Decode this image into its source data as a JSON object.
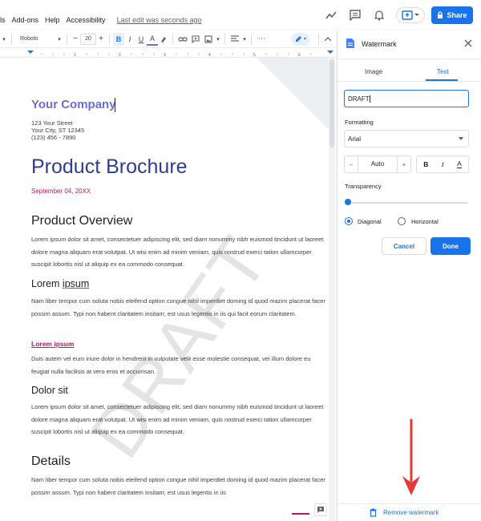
{
  "menu": {
    "items": [
      "ls",
      "Add-ons",
      "Help",
      "Accessibility"
    ],
    "last_edit": "Last edit was seconds ago"
  },
  "header": {
    "share_label": "Share",
    "icons": [
      "trend-icon",
      "comment-icon",
      "bell-icon",
      "present-icon",
      "lock-icon"
    ]
  },
  "toolbar": {
    "font": "Roboto",
    "font_size": "20",
    "bold": "B",
    "italic": "I",
    "underline": "U",
    "text_color": "A"
  },
  "document": {
    "company": "Your Company",
    "address": [
      "123 Your Street",
      "Your City, ST 12345",
      "(123) 456 - 7890"
    ],
    "title": "Product Brochure",
    "date": "September 04, 20XX",
    "section1": {
      "heading": "Product Overview",
      "body": "Lorem ipsum dolor sit amet, consectetuer adipiscing elit, sed diam nonummy nibh euismod tincidunt ut laoreet dolore magna aliquam erat volutpat. Ut wisi enim ad minim veniam, quis nostrud exerci tation ullamcorper suscipit lobortis nisl ut aliquip ex ea commodo consequat."
    },
    "section2": {
      "heading_part1": "Lorem",
      "heading_part2": "ipsum",
      "body": "Nam liber tempor cum soluta nobis eleifend option congue nihil imperdiet doming id quod mazim placerat facer possim assum. Typi non habent claritatem insitam; est usus legentis in iis qui facit eorum claritatem."
    },
    "section3": {
      "heading_part1": "Lorem",
      "heading_part2": "ipsum",
      "body": "Duis autem vel eum iriure dolor in hendrerit in vulputate velit esse molestie consequat, vel illum dolore eu feugiat nulla facilisis at vero eros et accumsan."
    },
    "section4": {
      "heading": "Dolor sit",
      "body": "Lorem ipsum dolor sit amet, consectetuer adipiscing elit, sed diam nonummy nibh euismod tincidunt ut laoreet dolore magna aliquam erat volutpat. Ut wisi enim ad minim veniam, quis nostrud exerci tation ullamcorper suscipit lobortis nisl ut aliquip ex ea commodo consequat."
    },
    "section5": {
      "heading": "Details",
      "body": "Nam liber tempor cum soluta nobis eleifend option congue nihil imperdiet doming id quod mazim placerat facer possim assum. Typi non habent claritatem insitam; est usus legentis in iis"
    },
    "watermark_text": "DRAFT"
  },
  "panel": {
    "title": "Watermark",
    "tabs": [
      "Image",
      "Text"
    ],
    "active_tab": "Text",
    "text_value": "DRAFT",
    "formatting_label": "Formatting",
    "font_value": "Arial",
    "size_minus": "−",
    "size_value": "Auto",
    "size_plus": "+",
    "format_bold": "B",
    "format_italic": "I",
    "format_color": "A",
    "transparency_label": "Transparency",
    "transparency_level": 0,
    "orientation": [
      "Diagonal",
      "Horizontal"
    ],
    "orientation_selected": "Diagonal",
    "cancel_label": "Cancel",
    "done_label": "Done",
    "remove_label": "Remove watermark"
  },
  "colors": {
    "accent": "#1a73e8",
    "arrow": "#e53935",
    "company": "#6c6cd3",
    "title": "#2c3e91",
    "date": "#c2185b"
  }
}
